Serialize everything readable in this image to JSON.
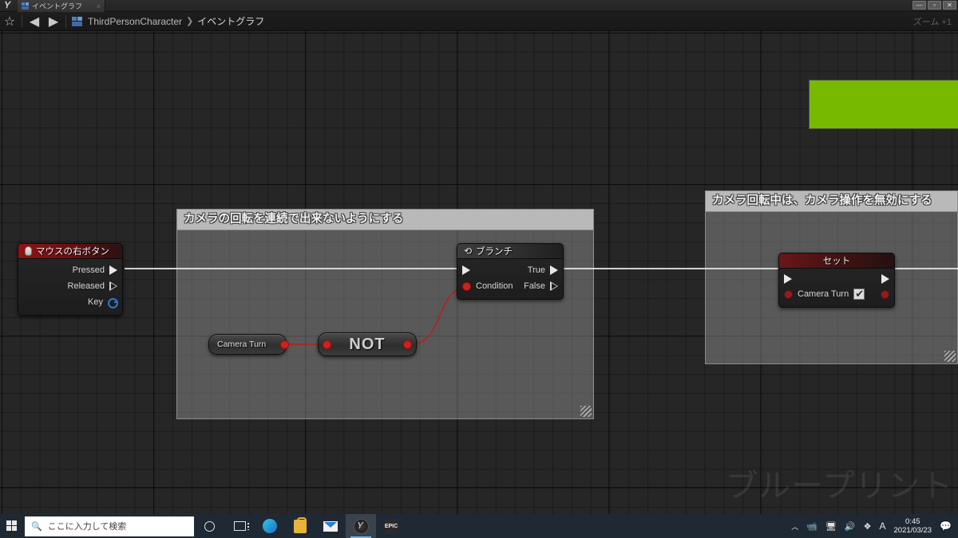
{
  "window": {
    "tab_label": "イベントグラフ",
    "tab_close": "×",
    "logo": "ue-logo",
    "controls": {
      "minimize": "—",
      "maximize": "▫",
      "close": "✕"
    }
  },
  "breadcrumb": {
    "favorite_icon": "☆",
    "back_icon": "◀",
    "forward_icon": "▶",
    "blueprint_name": "ThirdPersonCharacter",
    "separator": "❯",
    "graph_name": "イベントグラフ",
    "zoom_label": "ズーム +1"
  },
  "graph": {
    "watermark": "ブループリント",
    "green_rect_color": "#76b900",
    "comments": [
      {
        "id": "comment-left",
        "title": "カメラの回転を連続で出来ないようにする"
      },
      {
        "id": "comment-right",
        "title": "カメラ回転中は、カメラ操作を無効にする"
      }
    ],
    "nodes": {
      "event_mouse_right": {
        "title": "マウスの右ボタン",
        "icon": "mouse-icon",
        "pins": [
          {
            "label": "Pressed",
            "type": "exec",
            "filled": true
          },
          {
            "label": "Released",
            "type": "exec",
            "filled": false
          },
          {
            "label": "Key",
            "type": "key"
          }
        ]
      },
      "branch": {
        "title": "ブランチ",
        "icon": "branch-icon",
        "in_exec": "",
        "in_condition": "Condition",
        "out_true": "True",
        "out_false": "False"
      },
      "not_node": {
        "title": "NOT"
      },
      "camera_turn_get": {
        "title": "Camera Turn"
      },
      "set_node": {
        "title": "セット",
        "variable": "Camera Turn",
        "value_checked": true
      }
    }
  },
  "taskbar": {
    "start_icon": "windows-icon",
    "search_placeholder": "ここに入力して検索",
    "search_icon": "search-icon",
    "items": [
      {
        "name": "cortana-icon"
      },
      {
        "name": "task-view-icon"
      },
      {
        "name": "edge-icon"
      },
      {
        "name": "microsoft-store-icon"
      },
      {
        "name": "mail-icon"
      },
      {
        "name": "unreal-engine-icon"
      },
      {
        "name": "epic-games-icon",
        "label": "EPIC"
      }
    ],
    "tray": {
      "chevron": "︿",
      "icons": [
        "meet-now-icon",
        "network-icon",
        "volume-icon",
        "bluetooth-icon",
        "ime-icon"
      ],
      "ime_label": "A",
      "time": "0:45",
      "date": "2021/03/23",
      "action_center": "notification-icon"
    }
  }
}
